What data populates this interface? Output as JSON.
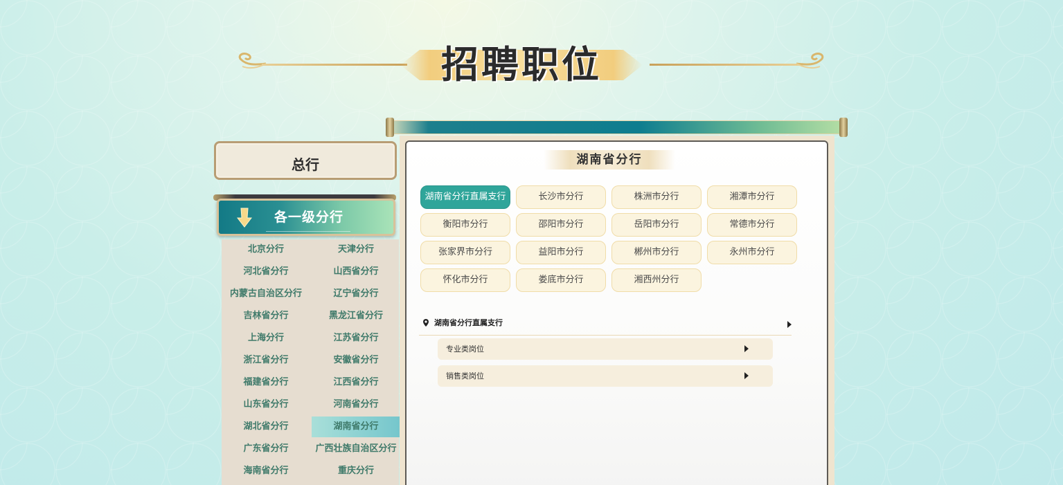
{
  "page": {
    "title": "招聘职位"
  },
  "sidebar": {
    "hq_label": "总行",
    "branches_header": "各一级分行",
    "branches": [
      {
        "label": "北京分行"
      },
      {
        "label": "天津分行"
      },
      {
        "label": "河北省分行"
      },
      {
        "label": "山西省分行"
      },
      {
        "label": "内蒙古自治区分行"
      },
      {
        "label": "辽宁省分行"
      },
      {
        "label": "吉林省分行"
      },
      {
        "label": "黑龙江省分行"
      },
      {
        "label": "上海分行"
      },
      {
        "label": "江苏省分行"
      },
      {
        "label": "浙江省分行"
      },
      {
        "label": "安徽省分行"
      },
      {
        "label": "福建省分行"
      },
      {
        "label": "江西省分行"
      },
      {
        "label": "山东省分行"
      },
      {
        "label": "河南省分行"
      },
      {
        "label": "湖北省分行"
      },
      {
        "label": "湖南省分行"
      },
      {
        "label": "广东省分行"
      },
      {
        "label": "广西壮族自治区分行"
      },
      {
        "label": "海南省分行"
      },
      {
        "label": "重庆分行"
      }
    ],
    "active_branch": "湖南省分行"
  },
  "panel": {
    "title": "湖南省分行",
    "cities": [
      {
        "label": "湖南省分行直属支行"
      },
      {
        "label": "长沙市分行"
      },
      {
        "label": "株洲市分行"
      },
      {
        "label": "湘潭市分行"
      },
      {
        "label": "衡阳市分行"
      },
      {
        "label": "邵阳市分行"
      },
      {
        "label": "岳阳市分行"
      },
      {
        "label": "常德市分行"
      },
      {
        "label": "张家界市分行"
      },
      {
        "label": "益阳市分行"
      },
      {
        "label": "郴州市分行"
      },
      {
        "label": "永州市分行"
      },
      {
        "label": "怀化市分行"
      },
      {
        "label": "娄底市分行"
      },
      {
        "label": "湘西州分行"
      }
    ],
    "active_city": "湖南省分行直属支行",
    "location": "湖南省分行直属支行",
    "job_categories": [
      {
        "label": "专业类岗位"
      },
      {
        "label": "销售类岗位"
      }
    ]
  },
  "colors": {
    "accent_teal": "#2fa59a",
    "branch_text": "#3f7a6a",
    "gold": "#f2cd7e"
  },
  "icons": [
    "ornament-curl-icon",
    "arrow-down-icon",
    "location-pin-icon",
    "triangle-right-icon"
  ]
}
